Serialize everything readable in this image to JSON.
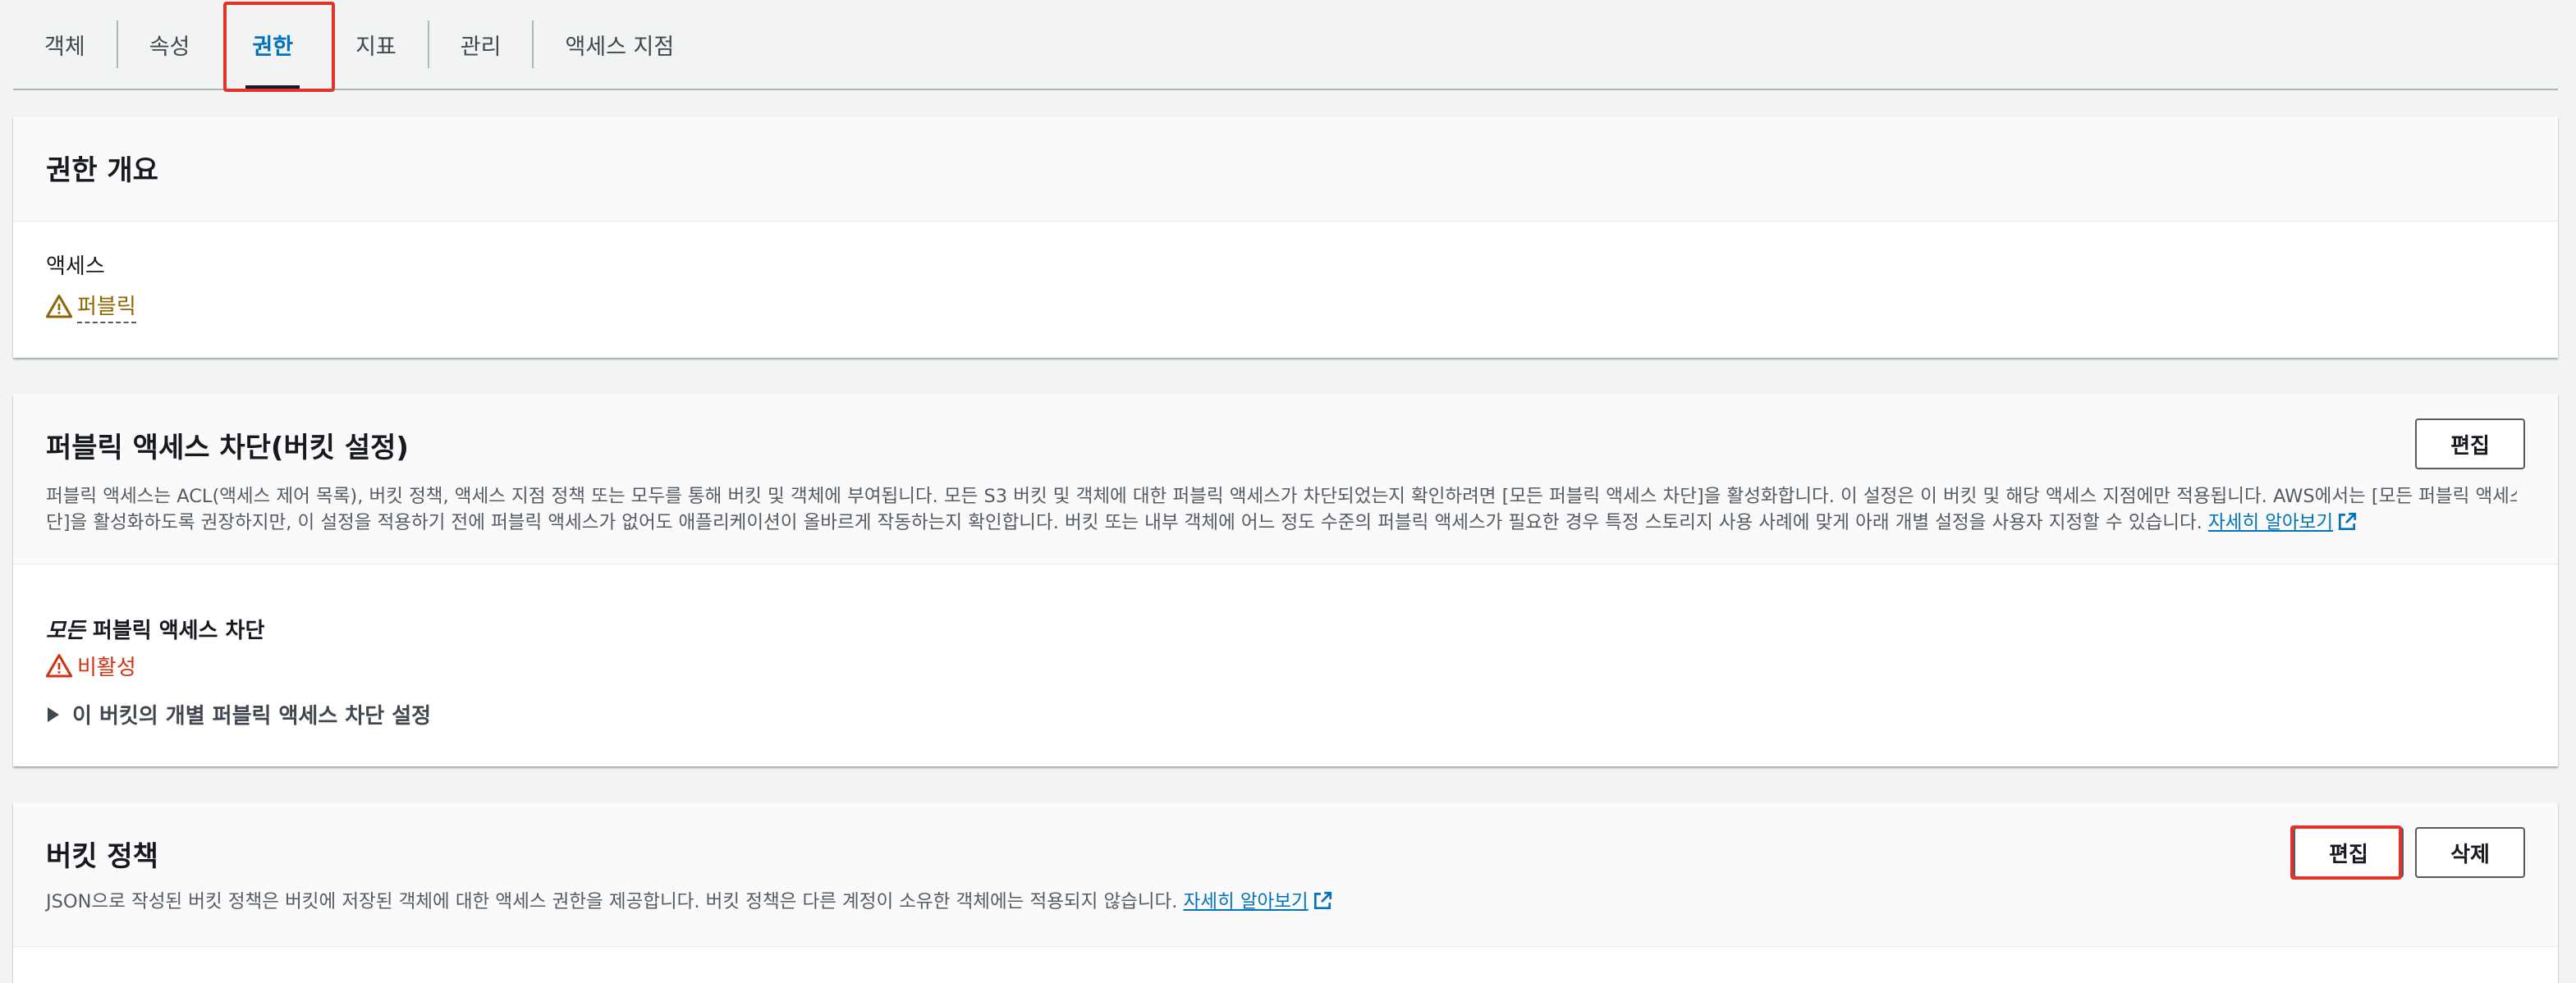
{
  "tabs": [
    {
      "label": "객체"
    },
    {
      "label": "속성"
    },
    {
      "label": "권한"
    },
    {
      "label": "지표"
    },
    {
      "label": "관리"
    },
    {
      "label": "액세스 지점"
    }
  ],
  "active_tab": "권한",
  "overview": {
    "title": "권한 개요",
    "access_label": "액세스",
    "access_value": "퍼블릭"
  },
  "block_public": {
    "title": "퍼블릭 액세스 차단(버킷 설정)",
    "edit_label": "편집",
    "desc_line1": "퍼블릭 액세스는 ACL(액세스 제어 목록), 버킷 정책, 액세스 지점 정책 또는 모두를 통해 버킷 및 객체에 부여됩니다. 모든 S3 버킷 및 객체에 대한 퍼블릭 액세스가 차단되었는지 확인하려면 [모든 퍼블릭 액세스 차단]을 활성화합니다. 이 설정은 이 버킷 및 해당 액세스 지점에만 적용됩니다. AWS에서는 [모든 퍼블릭 액세스 차",
    "desc_line2": "단]을 활성화하도록 권장하지만, 이 설정을 적용하기 전에 퍼블릭 액세스가 없어도 애플리케이션이 올바르게 작동하는지 확인합니다. 버킷 또는 내부 객체에 어느 정도 수준의 퍼블릭 액세스가 필요한 경우 특정 스토리지 사용 사례에 맞게 아래 개별 설정을 사용자 지정할 수 있습니다.",
    "learn_more": "자세히 알아보기",
    "all_prefix": "모든",
    "all_suffix": " 퍼블릭 액세스 차단",
    "status": "비활성",
    "expand_label": "이 버킷의 개별 퍼블릭 액세스 차단 설정"
  },
  "bucket_policy": {
    "title": "버킷 정책",
    "desc": "JSON으로 작성된 버킷 정책은 버킷에 저장된 객체에 대한 액세스 권한을 제공합니다. 버킷 정책은 다른 계정이 소유한 객체에는 적용되지 않습니다.",
    "learn_more": "자세히 알아보기",
    "edit_label": "편집",
    "delete_label": "삭제"
  },
  "colors": {
    "accent": "#0073bb",
    "highlight": "#e4322b",
    "warning_public": "#8d6605",
    "warning_off": "#d13212"
  }
}
